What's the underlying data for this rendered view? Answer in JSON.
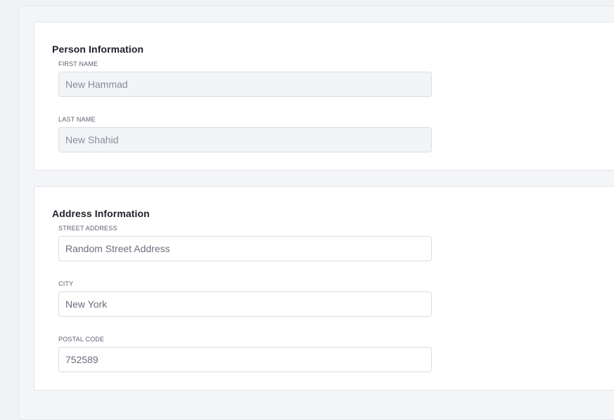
{
  "person_section": {
    "title": "Person Information",
    "first_name": {
      "label": "FIRST NAME",
      "value": "New Hammad",
      "disabled": true
    },
    "last_name": {
      "label": "LAST NAME",
      "value": "New Shahid",
      "disabled": true
    }
  },
  "address_section": {
    "title": "Address Information",
    "street": {
      "label": "STREET ADDRESS",
      "value": "Random Street Address"
    },
    "city": {
      "label": "CITY",
      "value": "New York"
    },
    "postal_code": {
      "label": "POSTAL CODE",
      "value": "752589"
    }
  }
}
